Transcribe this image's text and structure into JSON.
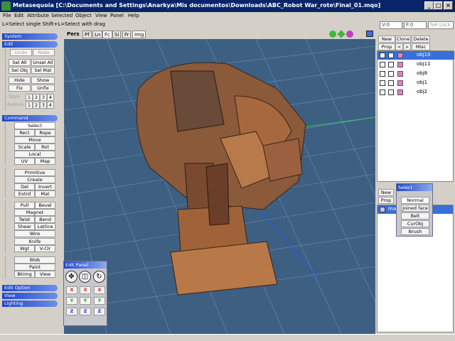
{
  "window": {
    "title": "Metasequoia [C:\\Documents and Settings\\Anarkya\\Mis documentos\\Downloads\\ABC_Robot War_rote\\Final_01.mqo]"
  },
  "menu": [
    "File",
    "Edit",
    "Attribute",
    "Selected",
    "Object",
    "View",
    "Panel",
    "Help"
  ],
  "status": {
    "hint": "L=Select single  Shift+L=Select with drag",
    "vertex": "V:0",
    "face": "F:0",
    "sel_lock": "Sel Lock"
  },
  "left": {
    "system": "System",
    "edit": "Edit",
    "edit_buttons": {
      "undo": "Undo",
      "redo": "Redo",
      "sel_all": "Sel All",
      "unsel_all": "Unsel All",
      "sel_obj": "Sel Obj",
      "sel_mat": "Sel Mat",
      "hide": "Hide",
      "show": "Show",
      "fix": "Fix",
      "unfix": "Unfix"
    },
    "store_label": "Store",
    "restore_label": "Restore",
    "num1": "1",
    "num2": "2",
    "num3": "3",
    "num4": "4",
    "command": "Command",
    "cmd": {
      "select": "Select",
      "rect": "Rect",
      "rope": "Rope",
      "move": "Move",
      "scale": "Scale",
      "rot": "Rot",
      "local": "Local",
      "uv": "UV",
      "map": "Map",
      "primitive": "Primitive",
      "create": "Create",
      "del": "Del",
      "invert": "Invert",
      "extrd": "Extrd",
      "mat": "Mat",
      "pull": "Pull",
      "bevel": "Bevel",
      "magnet": "Magnet",
      "twist": "Twist",
      "bend": "Bend",
      "shear": "Shear",
      "lattice": "Lattice",
      "wire": "Wire",
      "knife": "Knife",
      "wgt": "Wgt",
      "vclr": "V-Clr",
      "blob": "Blob",
      "paint": "Paint",
      "bkimg": "Bkimg",
      "view": "View"
    },
    "edit_option": "Edit Option",
    "view_hdr": "View",
    "lighting": "Lighting"
  },
  "viewtabs": {
    "pers": "Pers",
    "pf": "Pf",
    "ln": "Ln",
    "fc": "Fc",
    "si": "Si",
    "fr": "Fr",
    "img": "Img"
  },
  "editpanel": {
    "title": "Edit Panel",
    "move_icon": "✥",
    "scale_icon": "◫",
    "rot_icon": "↻",
    "x": "X",
    "y": "Y",
    "z": "Z"
  },
  "objects": {
    "new": "New",
    "clone": "Clone",
    "delete": "Delete",
    "prop": "Prop",
    "lt": "<",
    "gt": ">",
    "misc": "Misc",
    "items": [
      {
        "name": "obj10",
        "selected": true
      },
      {
        "name": "obj11",
        "selected": false
      },
      {
        "name": "obj8",
        "selected": false
      },
      {
        "name": "obj1",
        "selected": false
      },
      {
        "name": "obj2",
        "selected": false
      }
    ]
  },
  "materials": {
    "new": "New",
    "prop": "Prop",
    "item": "mat"
  },
  "select": {
    "title": "Select",
    "normal": "Normal",
    "joined": "Joined face",
    "belt": "Belt",
    "curobj": "CurObj",
    "brush": "Brush"
  },
  "colors": {
    "title_bg": "#0a246a",
    "viewport_bg": "#3d5f82",
    "selected_row": "#3a6fd8",
    "grid": "#6f8fb4",
    "axis_green": "#36c85a",
    "axis_blue": "#2a50ff"
  }
}
